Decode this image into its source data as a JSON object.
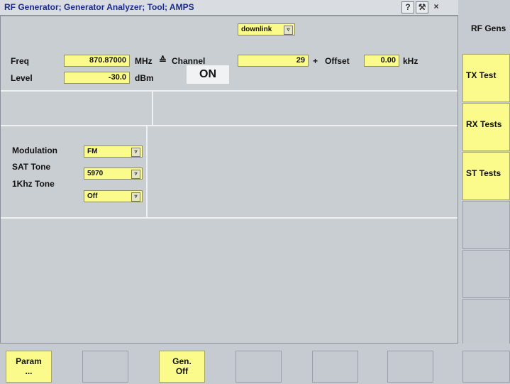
{
  "title": "RF Generator; Generator Analyzer; Tool; AMPS",
  "titlebar_buttons": {
    "help": "?",
    "tool": "⚒",
    "close": "×"
  },
  "link": "downlink",
  "freq": {
    "label": "Freq",
    "value": "870.87000",
    "unit": "MHz",
    "coupled_symbol": "≙"
  },
  "channel": {
    "label": "Channel",
    "value": "29"
  },
  "offset": {
    "plus": "+",
    "label": "Offset",
    "value": "0.00",
    "unit": "kHz"
  },
  "level": {
    "label": "Level",
    "value": "-30.0",
    "unit": "dBm"
  },
  "status": "ON",
  "modulation": {
    "label": "Modulation",
    "value": "FM"
  },
  "sat_tone": {
    "label": "SAT Tone",
    "value": "5970"
  },
  "khz_tone": {
    "label": "1Khz Tone",
    "value": "Off"
  },
  "right_keys": {
    "header": "RF Gens",
    "tx": "TX Test",
    "rx": "RX Tests",
    "st": "ST Tests"
  },
  "bottom_keys": {
    "param_line1": "Param",
    "param_line2": "...",
    "gen_line1": "Gen.",
    "gen_line2": "Off"
  }
}
